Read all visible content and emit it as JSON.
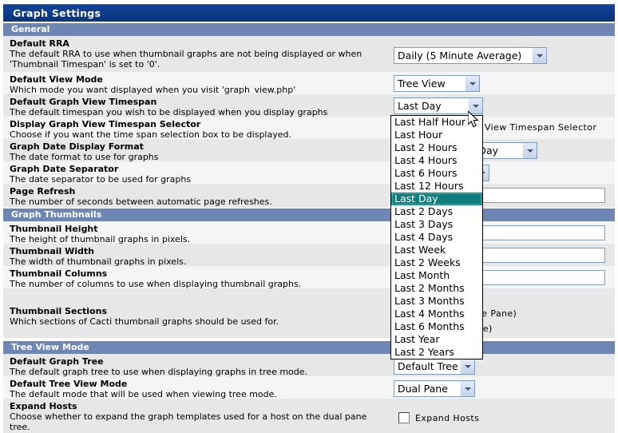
{
  "window": {
    "title": "Graph Settings"
  },
  "sections": [
    {
      "id": "general",
      "label": "General"
    },
    {
      "id": "graph_thumbnails",
      "label": "Graph Thumbnails"
    },
    {
      "id": "tree_view_mode",
      "label": "Tree View Mode"
    }
  ],
  "fields": {
    "default_rra": {
      "label": "Default RRA",
      "desc": "The default RRA to use when thumbnail graphs are not being displayed or when 'Thumbnail Timespan' is set to '0'.",
      "value": "Daily (5 Minute Average)"
    },
    "default_view_mode": {
      "label": "Default View Mode",
      "desc": "Which mode you want displayed when you visit 'graph_view.php'",
      "value": "Tree View"
    },
    "default_graph_view_timespan": {
      "label": "Default Graph View Timespan",
      "desc": "The default timespan you wish to be displayed when you display graphs",
      "value": "Last Day"
    },
    "display_timespan_selector": {
      "label": "Display Graph View Timespan Selector",
      "desc": "Choose if you want the time span selection box to be displayed.",
      "checkbox_label": "Display Graph View Timespan Selector",
      "checked": true
    },
    "graph_date_display_format": {
      "label": "Graph Date Display Format",
      "desc": "The date format to use for graphs",
      "value": "Month Number, Day"
    },
    "graph_date_separator": {
      "label": "Graph Date Separator",
      "desc": "The date separator to be used for graphs",
      "value": ""
    },
    "page_refresh": {
      "label": "Page Refresh",
      "desc": "The number of seconds between automatic page refreshes.",
      "value": ""
    },
    "thumbnail_height": {
      "label": "Thumbnail Height",
      "desc": "The height of thumbnail graphs in pixels.",
      "value": ""
    },
    "thumbnail_width": {
      "label": "Thumbnail Width",
      "desc": "The width of thumbnail graphs in pixels.",
      "value": ""
    },
    "thumbnail_columns": {
      "label": "Thumbnail Columns",
      "desc": "The number of columns to use when displaying thumbnail graphs.",
      "value": ""
    },
    "thumbnail_sections": {
      "label": "Thumbnail Sections",
      "desc": "Which sections of Cacti thumbnail graphs should be used for.",
      "option_1": "Preview (Single Pane)",
      "option_2": "Tree (Dual Pane)"
    },
    "default_graph_tree": {
      "label": "Default Graph Tree",
      "desc": "The default graph tree to use when displaying graphs in tree mode.",
      "value": "Default Tree"
    },
    "default_tree_view_mode": {
      "label": "Default Tree View Mode",
      "desc": "The default mode that will be used when viewing tree mode.",
      "value": "Dual Pane"
    },
    "expand_hosts": {
      "label": "Expand Hosts",
      "desc": "Choose whether to expand the graph templates used for a host on the dual pane tree.",
      "checkbox_label": "Expand Hosts",
      "checked": false
    }
  },
  "timespan_dropdown": {
    "open": true,
    "selected": "Last Day",
    "options": [
      "Last Half Hour",
      "Last Hour",
      "Last 2 Hours",
      "Last 4 Hours",
      "Last 6 Hours",
      "Last 12 Hours",
      "Last Day",
      "Last 2 Days",
      "Last 3 Days",
      "Last 4 Days",
      "Last Week",
      "Last 2 Weeks",
      "Last Month",
      "Last 2 Months",
      "Last 3 Months",
      "Last 4 Months",
      "Last 6 Months",
      "Last Year",
      "Last 2 Years"
    ]
  },
  "colors": {
    "title_bar": "#0a3a8c",
    "section_head": "#6d86b4",
    "row_alt_dark": "#e7e7e7",
    "row_alt_light": "#f5f5f5",
    "dropdown_selected": "#0d7d7d"
  }
}
